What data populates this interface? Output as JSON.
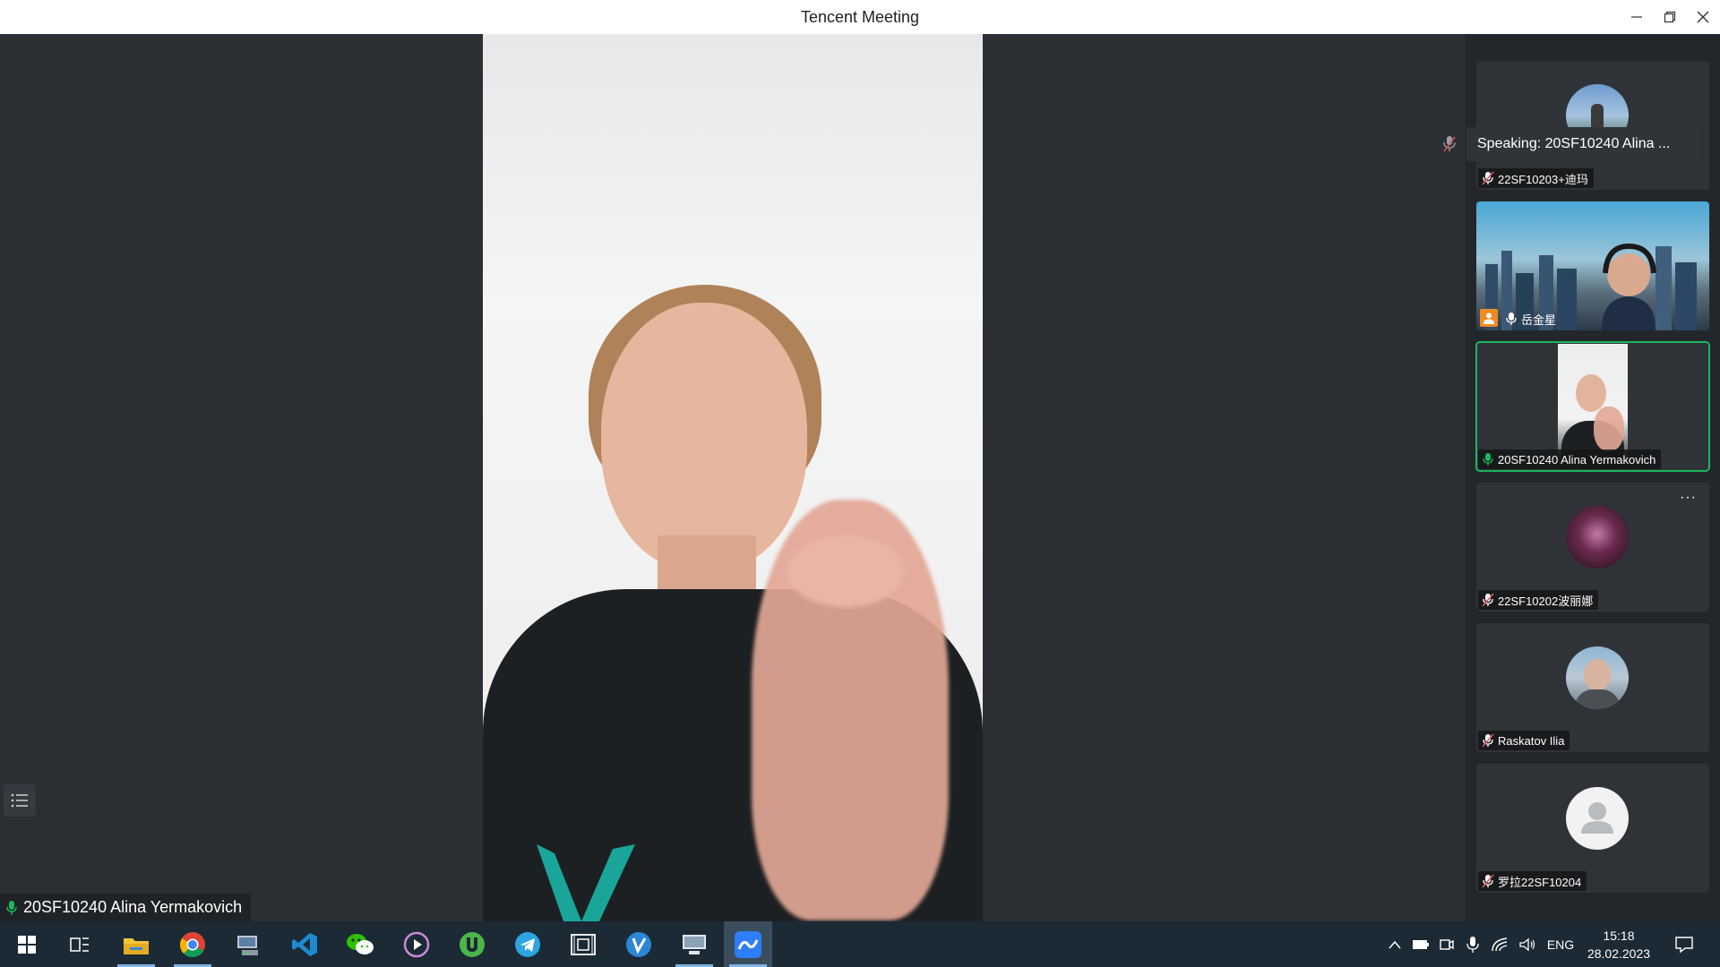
{
  "window": {
    "title": "Tencent Meeting"
  },
  "main": {
    "speaker_name": "20SF10240 Alina Yermakovich"
  },
  "speaking_banner": "Speaking: 20SF10240 Alina ...",
  "participants": [
    {
      "name": "22SF10203+迪玛",
      "mic": "muted"
    },
    {
      "name": "岳金星",
      "mic": "on"
    },
    {
      "name": "20SF10240 Alina Yermakovich",
      "mic": "active"
    },
    {
      "name": "22SF10202波丽娜",
      "mic": "muted"
    },
    {
      "name": "Raskatov Ilia",
      "mic": "muted"
    },
    {
      "name": "罗拉22SF10204",
      "mic": "muted"
    }
  ],
  "taskbar": {
    "apps": [
      "start-icon",
      "task-view-icon",
      "file-explorer-icon",
      "chrome-icon",
      "network-drive-icon",
      "vscode-icon",
      "wechat-icon",
      "media-player-icon",
      "utorrent-icon",
      "telegram-icon",
      "video-editor-icon",
      "viber-icon",
      "remote-desktop-icon",
      "tencent-meeting-icon"
    ],
    "language": "ENG",
    "time": "15:18",
    "date": "28.02.2023"
  },
  "colors": {
    "accent_green": "#1ab75e",
    "muted_red": "#e0505a",
    "taskbar": "#1b2a35"
  }
}
